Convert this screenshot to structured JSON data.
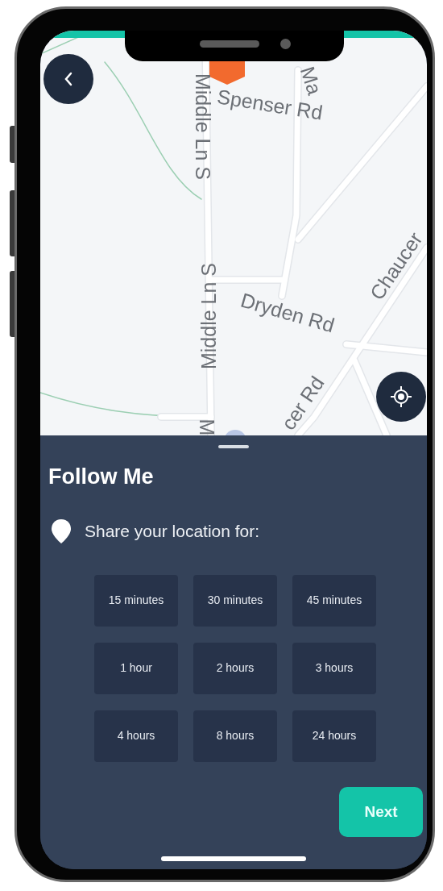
{
  "map": {
    "labels": [
      {
        "text": "Middle Ln S"
      },
      {
        "text": "Spenser Rd"
      },
      {
        "text": "Ma"
      },
      {
        "text": "Middle Ln S"
      },
      {
        "text": "Dryden Rd"
      },
      {
        "text": "Chaucer"
      },
      {
        "text": "cer Rd"
      },
      {
        "text": "M"
      }
    ]
  },
  "sheet": {
    "title": "Follow Me",
    "prompt": "Share your location for:",
    "options": [
      {
        "label": "15 minutes",
        "selected": false
      },
      {
        "label": "30 minutes",
        "selected": false
      },
      {
        "label": "45 minutes",
        "selected": false
      },
      {
        "label": "1 hour",
        "selected": false
      },
      {
        "label": "2 hours",
        "selected": false
      },
      {
        "label": "3 hours",
        "selected": false
      },
      {
        "label": "4 hours",
        "selected": false
      },
      {
        "label": "8 hours",
        "selected": false
      },
      {
        "label": "24 hours",
        "selected": false
      }
    ],
    "next_button": "Next"
  }
}
